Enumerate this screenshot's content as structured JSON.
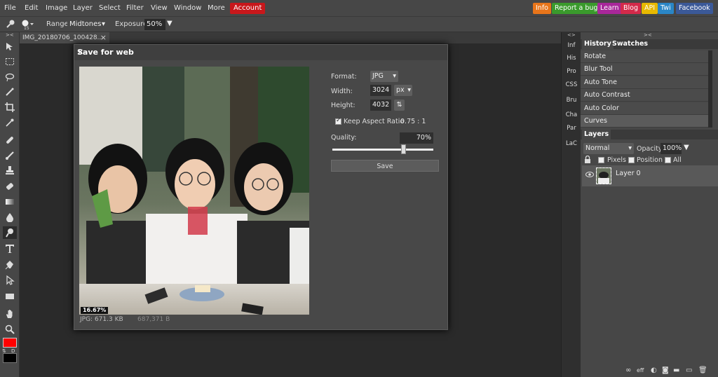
{
  "menu": {
    "items": [
      "File",
      "Edit",
      "Image",
      "Layer",
      "Select",
      "Filter",
      "View",
      "Window",
      "More"
    ],
    "account": "Account"
  },
  "extensions": [
    {
      "label": "Info",
      "color": "#e8751a"
    },
    {
      "label": "Report a bug",
      "color": "#3a9a2c"
    },
    {
      "label": "Learn",
      "color": "#a8279a"
    },
    {
      "label": "Blog",
      "color": "#d32a4a"
    },
    {
      "label": "API",
      "color": "#e6b800"
    },
    {
      "label": "Twi",
      "color": "#2a86c6"
    },
    {
      "label": "Facebook",
      "color": "#3b5998"
    }
  ],
  "options": {
    "brush_size": "15",
    "range_label": "Range:",
    "range_value": "Midtones",
    "exposure_label": "Exposure:",
    "exposure_value": "50%"
  },
  "document_tab": {
    "name": "IMG_20180706_100428...",
    "close": "×"
  },
  "dialog": {
    "title": "Save for web",
    "close": "✕",
    "format_label": "Format:",
    "format_value": "JPG",
    "width_label": "Width:",
    "width_value": "3024",
    "unit_value": "px",
    "height_label": "Height:",
    "height_value": "4032",
    "keep_aspect_label": "Keep Aspect Ratio",
    "aspect_ratio": "0.75 : 1",
    "quality_label": "Quality:",
    "quality_value": "70%",
    "quality_fraction": 0.7,
    "save_label": "Save",
    "zoom": "16.67%",
    "file_size": "JPG:  671.3 KB",
    "file_bytes": "687,371 B"
  },
  "panel_strip": [
    "Inf",
    "His",
    "Pro",
    "CSS",
    "Bru",
    "Cha",
    "Par",
    "LaC"
  ],
  "history": {
    "tabs": [
      "History",
      "Swatches"
    ],
    "items": [
      "Rotate",
      "Blur Tool",
      "Auto Tone",
      "Auto Contrast",
      "Auto Color",
      "Curves"
    ]
  },
  "layers": {
    "tab": "Layers",
    "blend_mode": "Normal",
    "opacity_label": "Opacity:",
    "opacity_value": "100%",
    "lock_label": "",
    "lock_pixels": "Pixels",
    "lock_position": "Position",
    "lock_all": "All",
    "layer_name": "Layer 0"
  },
  "colors": {
    "foreground": "#ff0000",
    "background": "#000000"
  }
}
